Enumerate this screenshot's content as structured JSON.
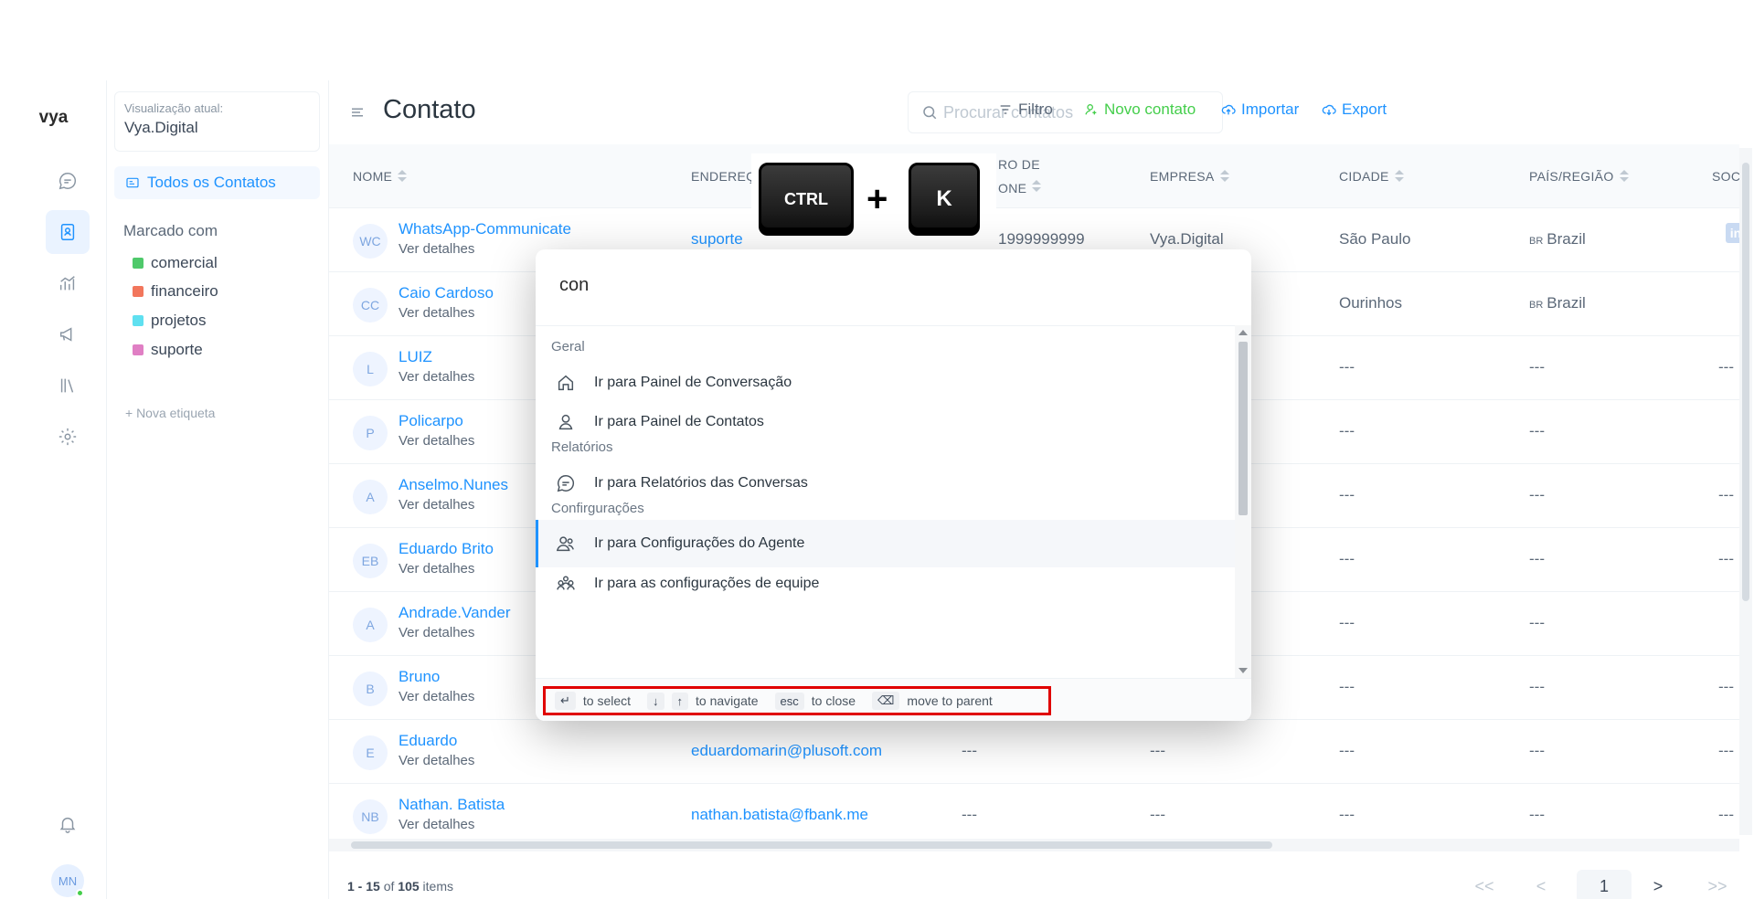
{
  "brand": "vya",
  "sidebar2": {
    "view_label": "Visualização atual:",
    "view_value": "Vya.Digital",
    "all_contacts": "Todos os Contatos",
    "tagged_title": "Marcado com",
    "labels": [
      {
        "name": "comercial",
        "color": "#4fc96b"
      },
      {
        "name": "financeiro",
        "color": "#f2765c"
      },
      {
        "name": "projetos",
        "color": "#5fe0f0"
      },
      {
        "name": "suporte",
        "color": "#e07fc4"
      }
    ],
    "new_label": "+ Nova etiqueta"
  },
  "header": {
    "title": "Contato",
    "search_placeholder": "Procurar contatos",
    "filter": "Filtro",
    "new_contact": "Novo contato",
    "import": "Importar",
    "export": "Export"
  },
  "columns": {
    "name": "NOME",
    "email": "ENDEREÇ",
    "phone_line1": "RO DE",
    "phone_line2": "ONE",
    "company": "EMPRESA",
    "city": "CIDADE",
    "country": "PAÍS/REGIÃO",
    "social": "SOC"
  },
  "rows": [
    {
      "initials": "WC",
      "name": "WhatsApp-Communicate",
      "details": "Ver detalhes",
      "email": "suporte",
      "phone": "1999999999",
      "company": "Vya.Digital",
      "city": "São Paulo",
      "flag": "BR",
      "country": "Brazil",
      "social": "in"
    },
    {
      "initials": "CC",
      "name": "Caio Cardoso",
      "details": "Ver detalhes",
      "email": "",
      "phone": "",
      "company": "",
      "city": "Ourinhos",
      "flag": "BR",
      "country": "Brazil",
      "social": ""
    },
    {
      "initials": "L",
      "name": "LUIZ",
      "details": "Ver detalhes",
      "email": "",
      "phone": "",
      "company": "",
      "city": "---",
      "flag": "",
      "country": "---",
      "social": "---"
    },
    {
      "initials": "P",
      "name": "Policarpo",
      "details": "Ver detalhes",
      "email": "",
      "phone": "",
      "company": "",
      "city": "---",
      "flag": "",
      "country": "---",
      "social": ""
    },
    {
      "initials": "A",
      "name": "Anselmo.Nunes",
      "details": "Ver detalhes",
      "email": "",
      "phone": "",
      "company": "",
      "city": "---",
      "flag": "",
      "country": "---",
      "social": "---"
    },
    {
      "initials": "EB",
      "name": "Eduardo Brito",
      "details": "Ver detalhes",
      "email": "",
      "phone": "",
      "company": "",
      "city": "---",
      "flag": "",
      "country": "---",
      "social": "---"
    },
    {
      "initials": "A",
      "name": "Andrade.Vander",
      "details": "Ver detalhes",
      "email": "",
      "phone": "",
      "company": "",
      "city": "---",
      "flag": "",
      "country": "---",
      "social": ""
    },
    {
      "initials": "B",
      "name": "Bruno",
      "details": "Ver detalhes",
      "email": "",
      "phone": "",
      "company": "",
      "city": "---",
      "flag": "",
      "country": "---",
      "social": "---"
    },
    {
      "initials": "E",
      "name": "Eduardo",
      "details": "Ver detalhes",
      "email": "eduardomarin@plusoft.com",
      "phone": "---",
      "company": "---",
      "city": "---",
      "flag": "",
      "country": "---",
      "social": "---"
    },
    {
      "initials": "NB",
      "name": "Nathan. Batista",
      "details": "Ver detalhes",
      "email": "nathan.batista@fbank.me",
      "phone": "---",
      "company": "---",
      "city": "---",
      "flag": "",
      "country": "---",
      "social": "---"
    }
  ],
  "footer": {
    "range": "1 - 15",
    "of": "of",
    "total": "105",
    "items": "items",
    "first": "<<",
    "prev": "<",
    "page": "1",
    "next": ">",
    "last": ">>"
  },
  "shortcut": {
    "ctrl": "CTRL",
    "plus": "+",
    "key": "K"
  },
  "palette": {
    "query": "con",
    "sections": [
      {
        "title": "Geral"
      },
      {
        "title": "Relatórios"
      },
      {
        "title": "Confirgurações"
      }
    ],
    "commands": [
      {
        "label": "Ir para Painel de Conversação",
        "icon": "home-icon"
      },
      {
        "label": "Ir para Painel de Contatos",
        "icon": "person-icon"
      },
      {
        "label": "Ir para Relatórios das Conversas",
        "icon": "chat-icon"
      },
      {
        "label": "Ir para Configurações do Agente",
        "icon": "people-icon"
      },
      {
        "label": "Ir para as configurações de equipe",
        "icon": "team-icon"
      }
    ],
    "hints": {
      "select": "to select",
      "navigate": "to navigate",
      "esc": "esc",
      "close": "to close",
      "parent": "move to parent"
    }
  },
  "colors": {
    "accent": "#1f93ff",
    "success": "#44ce4b",
    "highlight": "#e00000"
  }
}
